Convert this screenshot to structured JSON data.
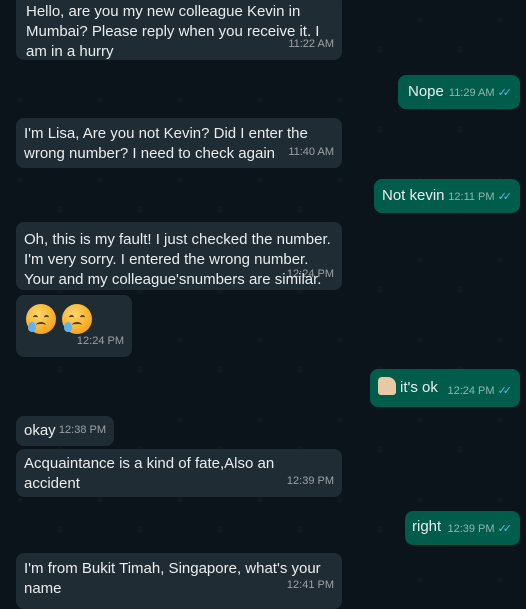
{
  "messages": [
    {
      "text": "Hello, are you my new colleague Kevin in Mumbai? Please reply when you receive it. I am in a hurry",
      "time": "11:22 AM"
    },
    {
      "text": "Nope",
      "time": "11:29 AM"
    },
    {
      "text": "I'm Lisa,  Are you not Kevin? Did I enter the wrong number?  I need to check again",
      "time": "11:40 AM"
    },
    {
      "text": "Not kevin",
      "time": "12:11 PM"
    },
    {
      "text": "Oh, this is my fault! I just checked the number. I'm very sorry. I entered the wrong number. Your and my colleague'snumbers are similar.",
      "time": "12:24 PM"
    },
    {
      "emojis": [
        "sad-tear-face",
        "sad-tear-face"
      ],
      "time": "12:24 PM"
    },
    {
      "text": "it's ok",
      "time": "12:24 PM",
      "emoji": "thumbs-up"
    },
    {
      "text": "okay",
      "time": "12:38 PM"
    },
    {
      "text": "Acquaintance is a kind of fate,Also an accident",
      "time": "12:39 PM"
    },
    {
      "text": "right",
      "time": "12:39 PM"
    },
    {
      "text": "I'm from Bukit Timah, Singapore, what's your name",
      "time": "12:41 PM"
    }
  ],
  "read_receipt": "✓✓",
  "colors": {
    "incoming": "#202c33",
    "outgoing": "#005c4b",
    "background": "#0b141a",
    "read_tick": "#53bdeb"
  }
}
